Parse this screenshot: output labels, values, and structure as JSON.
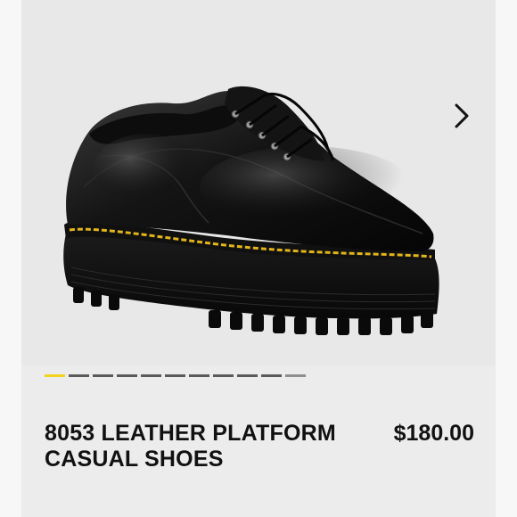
{
  "product": {
    "title": "8053 LEATHER PLATFORM CASUAL SHOES",
    "price": "$180.00",
    "image_icon": "shoe-image"
  },
  "gallery": {
    "next_icon": "chevron-right-icon",
    "slide_count": 11,
    "active_index": 0
  },
  "colors": {
    "background": "#ececec",
    "text": "#111111",
    "active_indicator": "#f2d21b",
    "inactive_indicator": "#5a5a5a",
    "welt_stitch": "#e2b51a"
  }
}
